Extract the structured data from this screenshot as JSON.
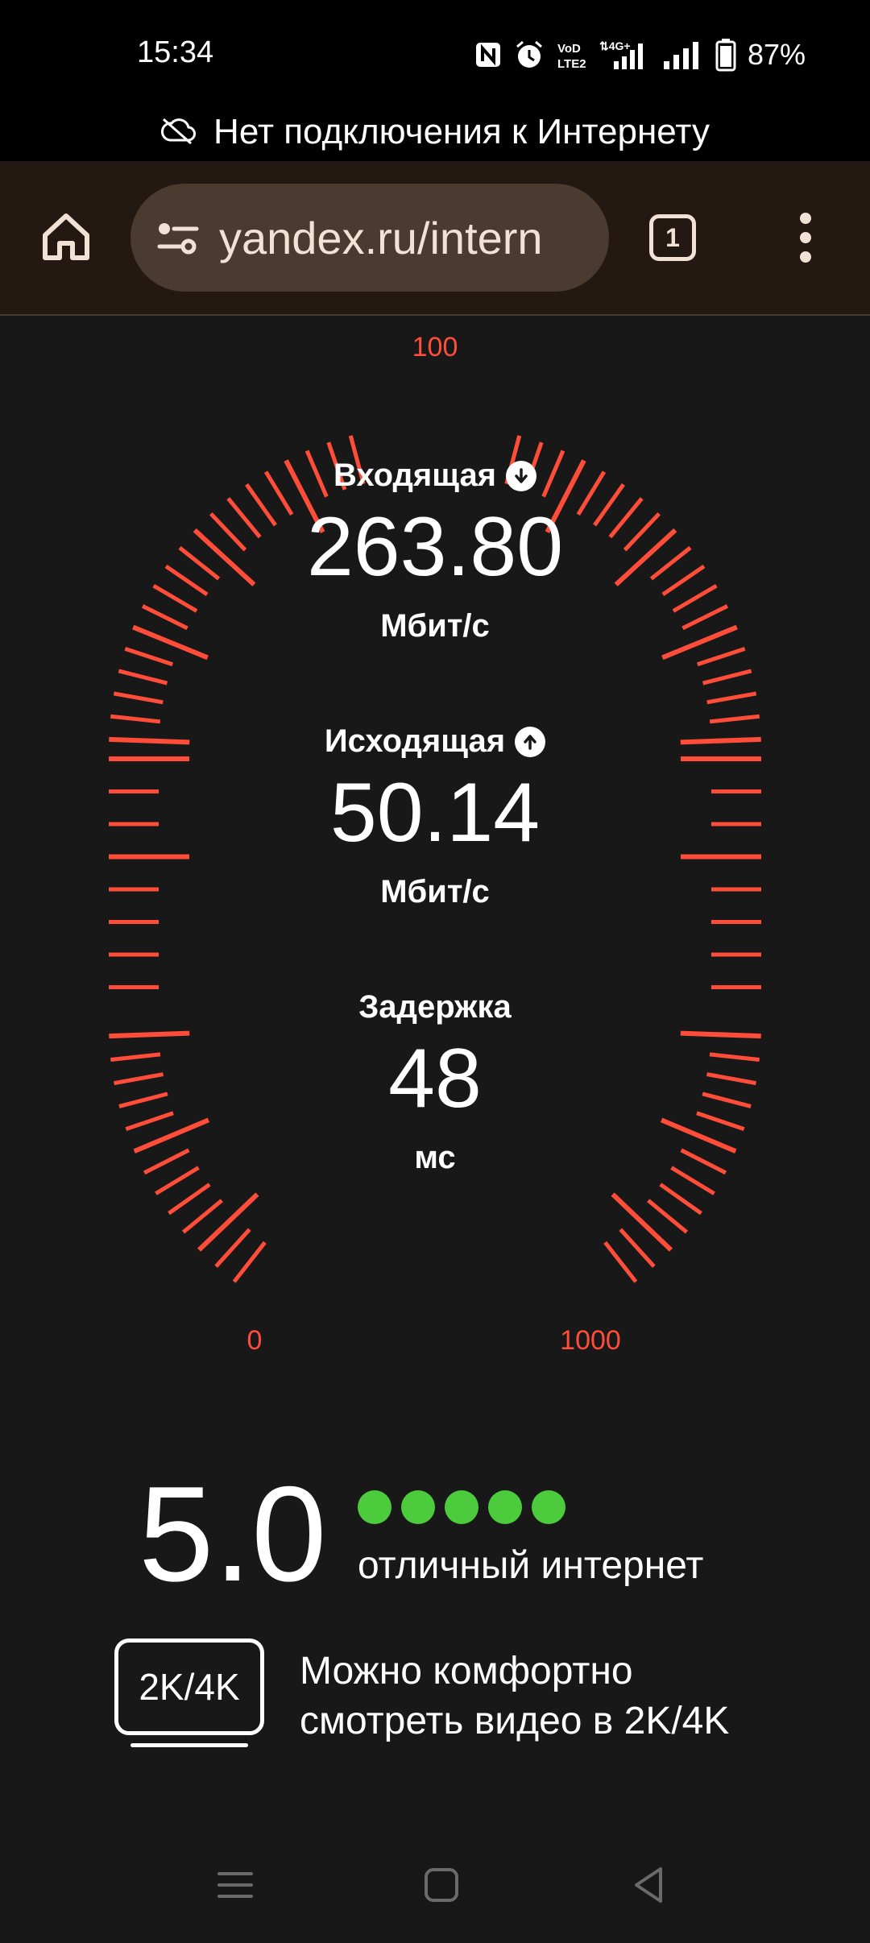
{
  "status_bar": {
    "time": "15:34",
    "battery": "87%",
    "icons": [
      "nfc-icon",
      "alarm-icon",
      "volte-icon",
      "4g-signal-icon",
      "signal-icon",
      "battery-icon"
    ]
  },
  "offline_banner": {
    "text": "Нет подключения к Интернету",
    "icon": "cloud-off-icon"
  },
  "browser": {
    "url": "yandex.ru/intern",
    "tab_count": "1",
    "icons": [
      "home-icon",
      "tune-icon",
      "tabs-icon",
      "more-vert-icon"
    ]
  },
  "gauge": {
    "accent_color": "#ff4d3a",
    "scale_labels": {
      "top": "100",
      "left_bottom": "0",
      "right_bottom": "1000"
    }
  },
  "speed": {
    "download": {
      "label": "Входящая",
      "value": "263.80",
      "unit": "Мбит/с",
      "icon": "arrow-down-icon"
    },
    "upload": {
      "label": "Исходящая",
      "value": "50.14",
      "unit": "Мбит/с",
      "icon": "arrow-up-icon"
    },
    "latency": {
      "label": "Задержка",
      "value": "48",
      "unit": "мс"
    }
  },
  "rating": {
    "score": "5.0",
    "dots_filled": 5,
    "dot_color": "#4ccb3c",
    "text": "отличный интернет"
  },
  "quality": {
    "badge": "2K/4K",
    "line1": "Можно комфортно",
    "line2": "смотреть видео в 2K/4K"
  },
  "nav_bar": {
    "icons": [
      "recents-icon",
      "home-square-icon",
      "back-icon"
    ]
  }
}
